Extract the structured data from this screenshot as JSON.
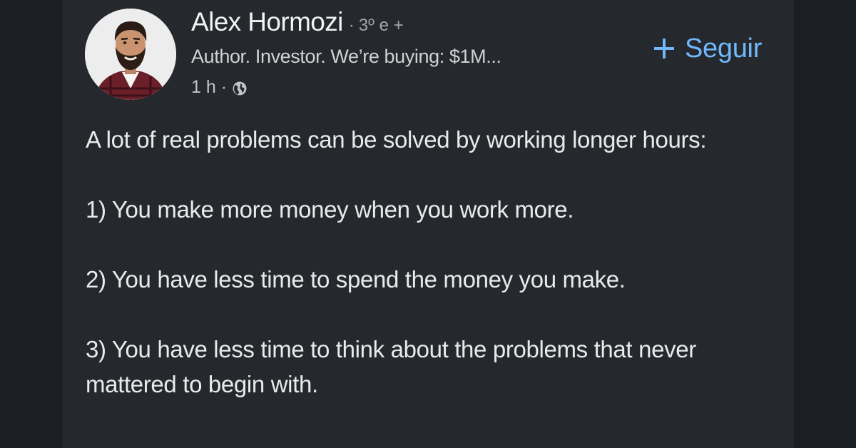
{
  "author": {
    "name": "Alex Hormozi",
    "connection_separator": "·",
    "connection_degree": "3º e +",
    "headline": "Author. Investor. We’re buying: $1M...",
    "time_ago": "1 h",
    "meta_separator": "·",
    "visibility_icon": "globe-icon"
  },
  "follow_button": {
    "icon": "plus-icon",
    "label": "Seguir"
  },
  "post": {
    "paragraphs": [
      "A lot of real problems can be solved by working longer hours:",
      "1) You make more money when you work more.",
      "2) You have less time to spend the money you make.",
      "3) You have less time to think about the problems that never mattered to begin with."
    ]
  },
  "colors": {
    "page_background": "#1b1f23",
    "card_background": "#25282c",
    "text_primary": "#e9eaeb",
    "text_secondary": "#c2c4c6",
    "link_blue": "#71b7fb"
  }
}
